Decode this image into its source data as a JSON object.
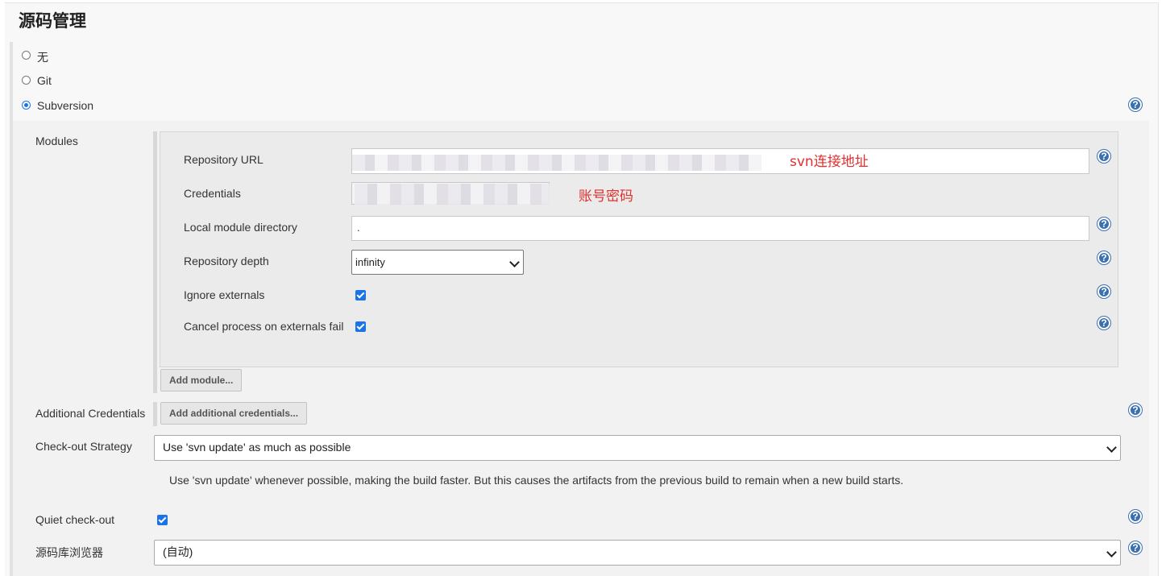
{
  "section": {
    "title": "源码管理"
  },
  "scm_options": [
    {
      "label": "无",
      "checked": false
    },
    {
      "label": "Git",
      "checked": false
    },
    {
      "label": "Subversion",
      "checked": true
    }
  ],
  "modules": {
    "label": "Modules",
    "repository_url_label": "Repository URL",
    "repository_url_value": "",
    "credentials_label": "Credentials",
    "local_dir_label": "Local module directory",
    "local_dir_value": ".",
    "depth_label": "Repository depth",
    "depth_value": "infinity",
    "ignore_externals_label": "Ignore externals",
    "ignore_externals_checked": true,
    "cancel_externals_label": "Cancel process on externals fail",
    "cancel_externals_checked": true,
    "add_module_button": "Add module..."
  },
  "annotations": {
    "url_note": "svn连接地址",
    "cred_note": "账号密码"
  },
  "additional_credentials": {
    "label": "Additional Credentials",
    "button": "Add additional credentials..."
  },
  "checkout_strategy": {
    "label": "Check-out Strategy",
    "value": "Use 'svn update' as much as possible",
    "description": "Use 'svn update' whenever possible, making the build faster. But this causes the artifacts from the previous build to remain when a new build starts."
  },
  "quiet_checkout": {
    "label": "Quiet check-out",
    "checked": true
  },
  "repo_browser": {
    "label": "源码库浏览器",
    "value": "(自动)"
  },
  "help_glyph": "?",
  "colors": {
    "accent": "#1a73e8",
    "annotation": "#e03030",
    "help": "#3a6fb0"
  }
}
